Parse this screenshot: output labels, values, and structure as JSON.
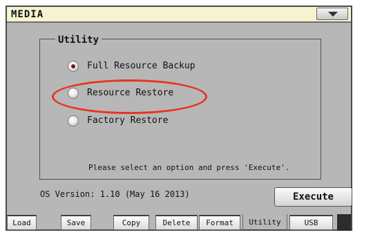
{
  "window": {
    "title": "MEDIA",
    "menu_icon": "chevron-down-icon"
  },
  "utility": {
    "legend": "Utility",
    "options": [
      {
        "label": "Full Resource Backup",
        "selected": true
      },
      {
        "label": "Resource Restore",
        "selected": false,
        "highlighted": true
      },
      {
        "label": "Factory Restore",
        "selected": false
      }
    ],
    "hint": "Please select an option and press 'Execute'."
  },
  "footer": {
    "os_version": "OS Version: 1.10 (May 16 2013)",
    "execute_label": "Execute"
  },
  "tabs": [
    {
      "label": "Load",
      "active": false
    },
    {
      "label": "Save",
      "active": false
    },
    {
      "label": "Copy",
      "active": false
    },
    {
      "label": "Delete",
      "active": false
    },
    {
      "label": "Format",
      "active": false
    },
    {
      "label": "Utility",
      "active": true
    },
    {
      "label": "USB",
      "active": false
    }
  ],
  "colors": {
    "panel_bg": "#b7b7b7",
    "titlebar_bg": "#f6f4d0",
    "highlight_ring": "#e8341c",
    "radio_selected_dot": "#7a1010"
  }
}
